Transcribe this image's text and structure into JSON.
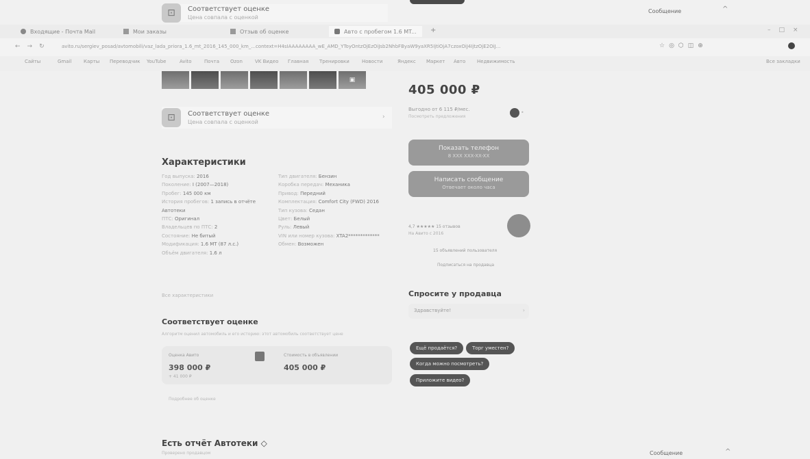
{
  "overlay": {
    "badge_title": "Соответствует оценке",
    "badge_sub": "Цена совпала с оценкой",
    "message_label": "Сообщение",
    "chevron": "^"
  },
  "tabs": [
    {
      "label": "Входящие - Почта Mail"
    },
    {
      "label": "Мои заказы"
    },
    {
      "label": "Отзыв об оценке"
    },
    {
      "label": "Авто с пробегом 1.6 MT..."
    }
  ],
  "url": "avito.ru/sergiev_posad/avtomobili/vaz_lada_priora_1.6_mt_2016_145_000_km_...context=H4sIAAAAAAAA_wE_AMD_YToyOntzOjEzOiJsb2NhbFByaW9yaXR5IjtiOjA7czoxOiJ4IjtzOjE2OiJ...",
  "bookmarks": [
    "Сайты",
    "Gmail",
    "Карты",
    "Переводчик",
    "YouTube",
    "Avito",
    "Почта",
    "Ozon",
    "VK Видео",
    "Главная",
    "Тренировки",
    "Новости",
    "Яндекс",
    "Маркет",
    "Авто",
    "Недвижимость",
    "Все закладки"
  ],
  "listing": {
    "price": "405 000 ₽",
    "price_note": "Выгодно от 6 115 ₽/мес.",
    "price_note2": "Посмотреть предложения",
    "show_phone": "Показать телефон",
    "show_phone_sub": "8 XXX XXX-XX-XX",
    "write_message": "Написать сообщение",
    "write_message_sub": "Отвечает около часа",
    "seller_rating": "4,7 ★★★★★ 15 отзывов",
    "seller_since": "На Авито с 2016",
    "seller_ads": "15 объявлений пользователя",
    "subscribe": "Подписаться на продавца"
  },
  "badge_card": {
    "title": "Соответствует оценке",
    "sub": "Цена совпала с оценкой"
  },
  "specs": {
    "title": "Характеристики",
    "left": [
      {
        "k": "Год выпуска:",
        "v": "2016"
      },
      {
        "k": "Поколение:",
        "v": "I (2007—2018)"
      },
      {
        "k": "Пробег:",
        "v": "145 000 км"
      },
      {
        "k": "История пробегов:",
        "v": "1 запись в отчёте Автотеки"
      },
      {
        "k": "ПТС:",
        "v": "Оригинал"
      },
      {
        "k": "Владельцев по ПТС:",
        "v": "2"
      },
      {
        "k": "Состояние:",
        "v": "Не битый"
      },
      {
        "k": "Модификация:",
        "v": "1.6 MT (87 л.с.)"
      },
      {
        "k": "Объём двигателя:",
        "v": "1.6 л"
      }
    ],
    "right": [
      {
        "k": "Тип двигателя:",
        "v": "Бензин"
      },
      {
        "k": "Коробка передач:",
        "v": "Механика"
      },
      {
        "k": "Привод:",
        "v": "Передний"
      },
      {
        "k": "Комплектация:",
        "v": "Comfort City (FWD) 2016"
      },
      {
        "k": "Тип кузова:",
        "v": "Седан"
      },
      {
        "k": "Цвет:",
        "v": "Белый"
      },
      {
        "k": "Руль:",
        "v": "Левый"
      },
      {
        "k": "VIN или номер кузова:",
        "v": "XTA2*************"
      },
      {
        "k": "Обмен:",
        "v": "Возможен"
      }
    ],
    "all_link": "Все характеристики"
  },
  "estimate": {
    "title": "Соответствует оценке",
    "desc": "Алгоритм оценил автомобиль и его историю: этот автомобиль соответствует цене",
    "label_left": "Оценка Авито",
    "value_left": "398 000 ₽",
    "delta_left": "+ 41 000 ₽",
    "label_right": "Стоимость в объявлении",
    "value_right": "405 000 ₽",
    "more_link": "Подробнее об оценке"
  },
  "ask": {
    "title": "Спросите у продавца",
    "input_value": "Здравствуйте!",
    "chips": [
      "Ещё продаётся?",
      "Торг уместен?",
      "Когда можно посмотреть?",
      "Приложите видео?"
    ]
  },
  "autoteka": {
    "title": "Есть отчёт Автотеки ◇",
    "sub": "Проверено продавцом"
  },
  "colors": {
    "background": "#e9e9e9",
    "button": "#9a9a9a",
    "chip": "#555555"
  }
}
